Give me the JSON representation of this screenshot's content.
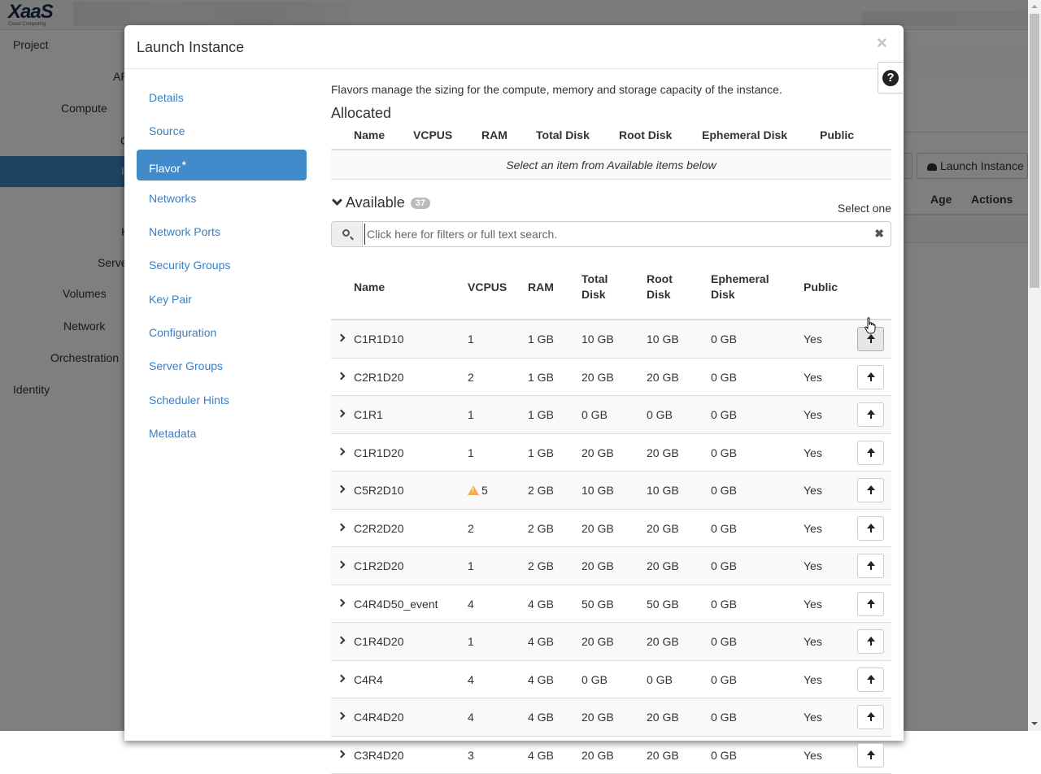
{
  "background": {
    "logo": {
      "main": "XaaS",
      "sub": "Cloud Computing"
    },
    "nav": {
      "project": "Project",
      "api": "AP",
      "compute": "Compute",
      "active_partial": "I",
      "partial_k": "K",
      "server_partial": "Serve",
      "volumes": "Volumes",
      "network": "Network",
      "orchestration": "Orchestration",
      "identity": "Identity",
      "partial_c": "C"
    },
    "launch_button": "Launch Instance",
    "table_headers": {
      "age": "Age",
      "actions": "Actions"
    }
  },
  "modal": {
    "title": "Launch Instance",
    "close_label": "×",
    "help_label": "?",
    "wizard_steps": [
      {
        "label": "Details",
        "active": false,
        "required": false
      },
      {
        "label": "Source",
        "active": false,
        "required": false
      },
      {
        "label": "Flavor",
        "active": true,
        "required": true
      },
      {
        "label": "Networks",
        "active": false,
        "required": false
      },
      {
        "label": "Network Ports",
        "active": false,
        "required": false
      },
      {
        "label": "Security Groups",
        "active": false,
        "required": false
      },
      {
        "label": "Key Pair",
        "active": false,
        "required": false
      },
      {
        "label": "Configuration",
        "active": false,
        "required": false
      },
      {
        "label": "Server Groups",
        "active": false,
        "required": false
      },
      {
        "label": "Scheduler Hints",
        "active": false,
        "required": false
      },
      {
        "label": "Metadata",
        "active": false,
        "required": false
      }
    ],
    "required_marker": "*",
    "flavor": {
      "description": "Flavors manage the sizing for the compute, memory and storage capacity of the instance.",
      "allocated": {
        "title": "Allocated",
        "columns": [
          "Name",
          "VCPUS",
          "RAM",
          "Total Disk",
          "Root Disk",
          "Ephemeral Disk",
          "Public"
        ],
        "empty_message": "Select an item from Available items below"
      },
      "available": {
        "title": "Available",
        "count": "37",
        "select_hint": "Select one",
        "search_placeholder": "Click here for filters or full text search.",
        "search_value": "",
        "clear_label": "✖",
        "columns": [
          {
            "line1": "Name",
            "line2": ""
          },
          {
            "line1": "VCPUS",
            "line2": ""
          },
          {
            "line1": "RAM",
            "line2": ""
          },
          {
            "line1": "Total",
            "line2": "Disk"
          },
          {
            "line1": "Root",
            "line2": "Disk"
          },
          {
            "line1": "Ephemeral",
            "line2": "Disk"
          },
          {
            "line1": "Public",
            "line2": ""
          }
        ],
        "rows": [
          {
            "name": "C1R1D10",
            "vcpus": "1",
            "ram": "1 GB",
            "total_disk": "10 GB",
            "root_disk": "10 GB",
            "ephemeral_disk": "0 GB",
            "public": "Yes",
            "warning": false
          },
          {
            "name": "C2R1D20",
            "vcpus": "2",
            "ram": "1 GB",
            "total_disk": "20 GB",
            "root_disk": "20 GB",
            "ephemeral_disk": "0 GB",
            "public": "Yes",
            "warning": false
          },
          {
            "name": "C1R1",
            "vcpus": "1",
            "ram": "1 GB",
            "total_disk": "0 GB",
            "root_disk": "0 GB",
            "ephemeral_disk": "0 GB",
            "public": "Yes",
            "warning": false
          },
          {
            "name": "C1R1D20",
            "vcpus": "1",
            "ram": "1 GB",
            "total_disk": "20 GB",
            "root_disk": "20 GB",
            "ephemeral_disk": "0 GB",
            "public": "Yes",
            "warning": false
          },
          {
            "name": "C5R2D10",
            "vcpus": "5",
            "ram": "2 GB",
            "total_disk": "10 GB",
            "root_disk": "10 GB",
            "ephemeral_disk": "0 GB",
            "public": "Yes",
            "warning": true
          },
          {
            "name": "C2R2D20",
            "vcpus": "2",
            "ram": "2 GB",
            "total_disk": "20 GB",
            "root_disk": "20 GB",
            "ephemeral_disk": "0 GB",
            "public": "Yes",
            "warning": false
          },
          {
            "name": "C1R2D20",
            "vcpus": "1",
            "ram": "2 GB",
            "total_disk": "20 GB",
            "root_disk": "20 GB",
            "ephemeral_disk": "0 GB",
            "public": "Yes",
            "warning": false
          },
          {
            "name": "C4R4D50_event",
            "vcpus": "4",
            "ram": "4 GB",
            "total_disk": "50 GB",
            "root_disk": "50 GB",
            "ephemeral_disk": "0 GB",
            "public": "Yes",
            "warning": false
          },
          {
            "name": "C1R4D20",
            "vcpus": "1",
            "ram": "4 GB",
            "total_disk": "20 GB",
            "root_disk": "20 GB",
            "ephemeral_disk": "0 GB",
            "public": "Yes",
            "warning": false
          },
          {
            "name": "C4R4",
            "vcpus": "4",
            "ram": "4 GB",
            "total_disk": "0 GB",
            "root_disk": "0 GB",
            "ephemeral_disk": "0 GB",
            "public": "Yes",
            "warning": false
          },
          {
            "name": "C4R4D20",
            "vcpus": "4",
            "ram": "4 GB",
            "total_disk": "20 GB",
            "root_disk": "20 GB",
            "ephemeral_disk": "0 GB",
            "public": "Yes",
            "warning": false
          },
          {
            "name": "C3R4D20",
            "vcpus": "3",
            "ram": "4 GB",
            "total_disk": "20 GB",
            "root_disk": "20 GB",
            "ephemeral_disk": "0 GB",
            "public": "Yes",
            "warning": false
          }
        ]
      }
    }
  },
  "colors": {
    "active_step": "#428bca",
    "link": "#3a7fc1",
    "warning": "#f0ad4e",
    "badge": "#bbbbbb"
  }
}
